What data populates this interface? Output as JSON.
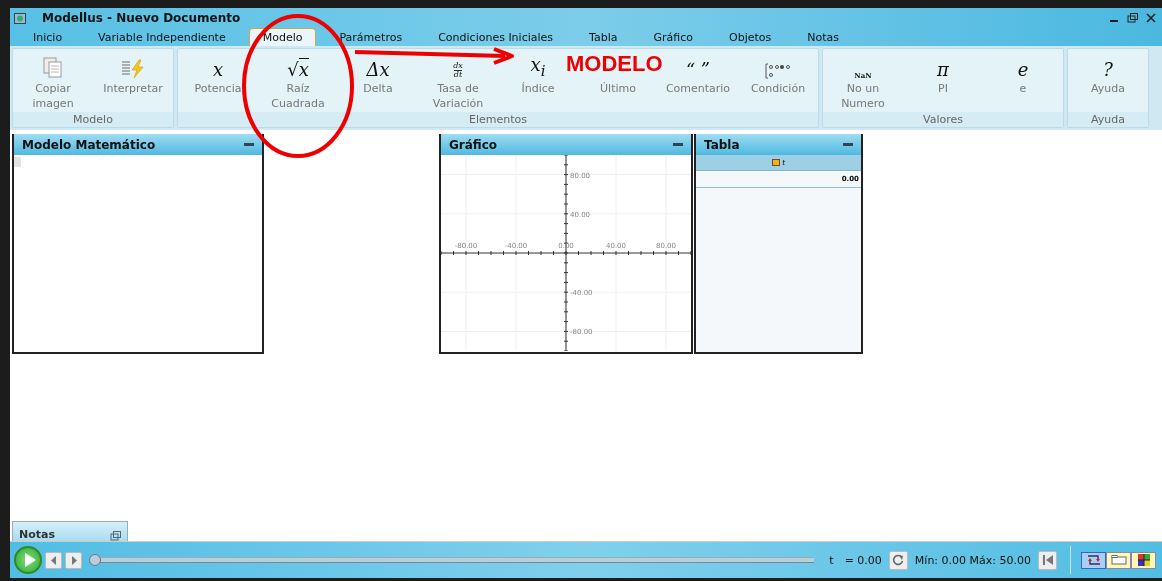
{
  "window": {
    "title": "Modellus - Nuevo Documento"
  },
  "tabs": [
    {
      "label": "Inicio",
      "selected": false
    },
    {
      "label": "Variable Independiente",
      "selected": false
    },
    {
      "label": "Modelo",
      "selected": true
    },
    {
      "label": "Parámetros",
      "selected": false
    },
    {
      "label": "Condiciones Iniciales",
      "selected": false
    },
    {
      "label": "Tabla",
      "selected": false
    },
    {
      "label": "Gráfico",
      "selected": false
    },
    {
      "label": "Objetos",
      "selected": false
    },
    {
      "label": "Notas",
      "selected": false
    }
  ],
  "ribbon": [
    {
      "name": "Modelo",
      "items": [
        {
          "label": "Copiar imagen",
          "kind": "copy"
        },
        {
          "label": "Interpretar",
          "kind": "interpret"
        }
      ]
    },
    {
      "name": "Elementos",
      "items": [
        {
          "label": "Potencia",
          "kind": "glyph",
          "glyph": "x"
        },
        {
          "label": "Raíz Cuadrada",
          "kind": "sqrt",
          "glyph": "√",
          "glyph2": "x"
        },
        {
          "label": "Delta",
          "kind": "glyph",
          "glyph": "Δx"
        },
        {
          "label": "Tasa de Variación",
          "kind": "frac",
          "glyph": "dx",
          "glyph2": "dt"
        },
        {
          "label": "Índice",
          "kind": "sub",
          "glyph": "x",
          "glyph2": "i"
        },
        {
          "label": "Último",
          "kind": "hidden"
        },
        {
          "label": "Comentario",
          "kind": "glyph",
          "glyph": "“ ”"
        },
        {
          "label": "Condición",
          "kind": "condition"
        }
      ]
    },
    {
      "name": "Valores",
      "items": [
        {
          "label": "No un Numero",
          "kind": "small",
          "glyph": "NaN"
        },
        {
          "label": "PI",
          "kind": "glyph",
          "glyph": "π"
        },
        {
          "label": "e",
          "kind": "glyph",
          "glyph": "e"
        }
      ]
    },
    {
      "name": "Ayuda",
      "items": [
        {
          "label": "Ayuda",
          "kind": "glyph",
          "glyph": "?"
        }
      ]
    }
  ],
  "panels": {
    "model": {
      "title": "Modelo Matemático"
    },
    "graph": {
      "title": "Gráfico",
      "chart_data": {
        "type": "line",
        "grid": true,
        "xlim": [
          -100,
          100
        ],
        "ylim": [
          -100,
          100
        ],
        "xticks": [
          {
            "value": -80,
            "label": "-80.00"
          },
          {
            "value": -40,
            "label": "-40.00"
          },
          {
            "value": 0,
            "label": "0.00"
          },
          {
            "value": 40,
            "label": "40.00"
          },
          {
            "value": 80,
            "label": "80.00"
          }
        ],
        "yticks": [
          {
            "value": 80,
            "label": "80.00"
          },
          {
            "value": 40,
            "label": "40.00"
          },
          {
            "value": -40,
            "label": "-40.00"
          },
          {
            "value": -80,
            "label": "-80.00"
          }
        ]
      }
    },
    "table": {
      "title": "Tabla",
      "columns": [
        "t"
      ],
      "rows": [
        [
          "0.00"
        ]
      ]
    },
    "notes": {
      "title": "Notas"
    }
  },
  "player": {
    "level": 0,
    "variable": "t",
    "value": "= 0.00",
    "range": "Mín: 0.00 Máx: 50.00",
    "views": [
      {
        "kind": "flow",
        "selected": true
      },
      {
        "kind": "card",
        "selected": false
      },
      {
        "kind": "grid",
        "selected": false
      }
    ]
  },
  "annotation": {
    "label": "MODELO"
  }
}
